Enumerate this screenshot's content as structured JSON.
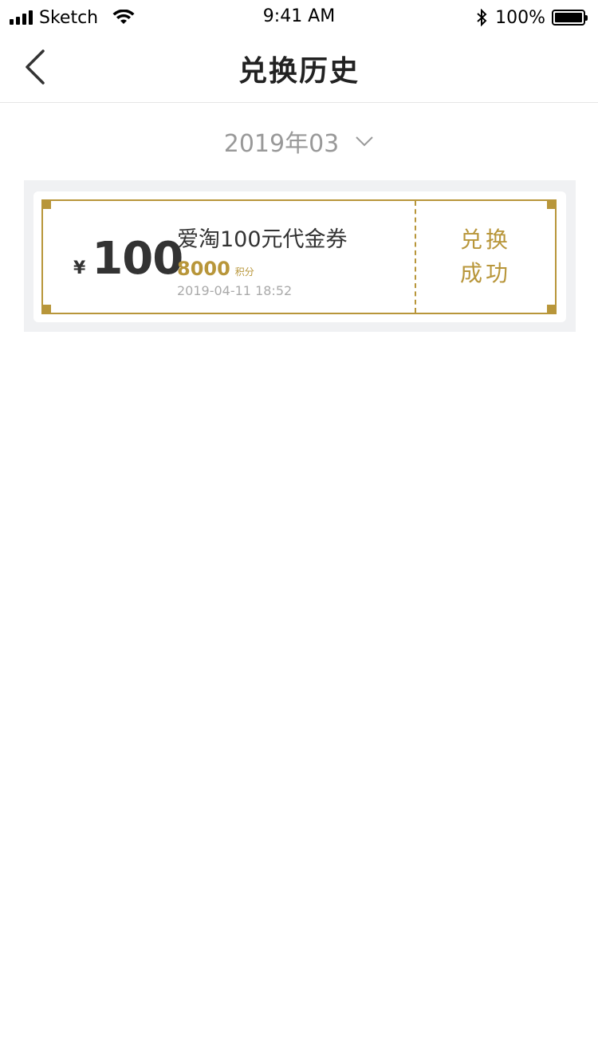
{
  "status_bar": {
    "carrier": "Sketch",
    "time": "9:41 AM",
    "battery": "100%"
  },
  "nav": {
    "title": "兑换历史"
  },
  "filter": {
    "month": "2019年03"
  },
  "records": [
    {
      "currency": "¥",
      "amount": "100",
      "name": "爱淘100元代金券",
      "points": "8000",
      "points_unit": "积分",
      "time": "2019-04-11 18:52",
      "status_line1": "兑换",
      "status_line2": "成功"
    }
  ],
  "colors": {
    "accent": "#b8963a",
    "list_background": "#f0f1f3"
  },
  "icons": {
    "back": "chevron-left-icon",
    "dropdown": "chevron-down-icon",
    "wifi": "wifi-icon",
    "bluetooth": "bluetooth-icon",
    "battery": "battery-icon"
  }
}
